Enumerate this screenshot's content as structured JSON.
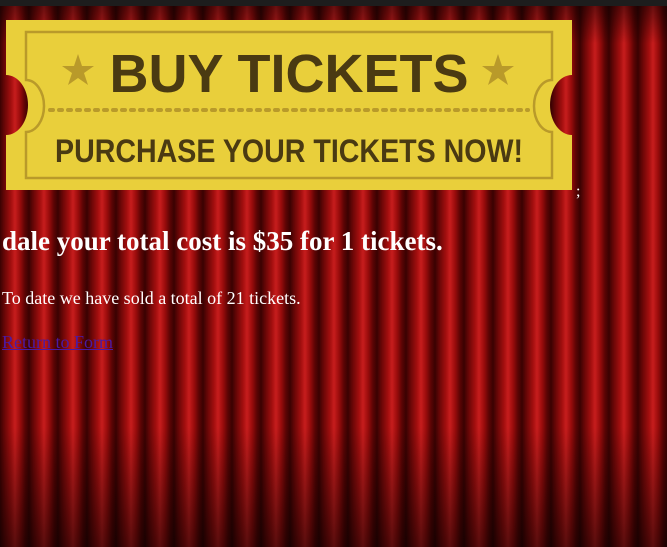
{
  "banner": {
    "title": "BUY TICKETS",
    "subtitle": "PURCHASE YOUR TICKETS NOW!",
    "trailing_char": ";",
    "colors": {
      "ticket_fill": "#e9cf3b",
      "ticket_text": "#4a3a12",
      "ticket_border": "#b99a2a"
    }
  },
  "result": {
    "heading": "dale your total cost is $35 for 1 tickets.",
    "sold_summary": "To date we have sold a total of 21 tickets.",
    "return_link": "Return to Form"
  },
  "colors": {
    "background_curtain": "#a30f0f",
    "text": "#ffffff",
    "link": "#4b1aa3"
  }
}
